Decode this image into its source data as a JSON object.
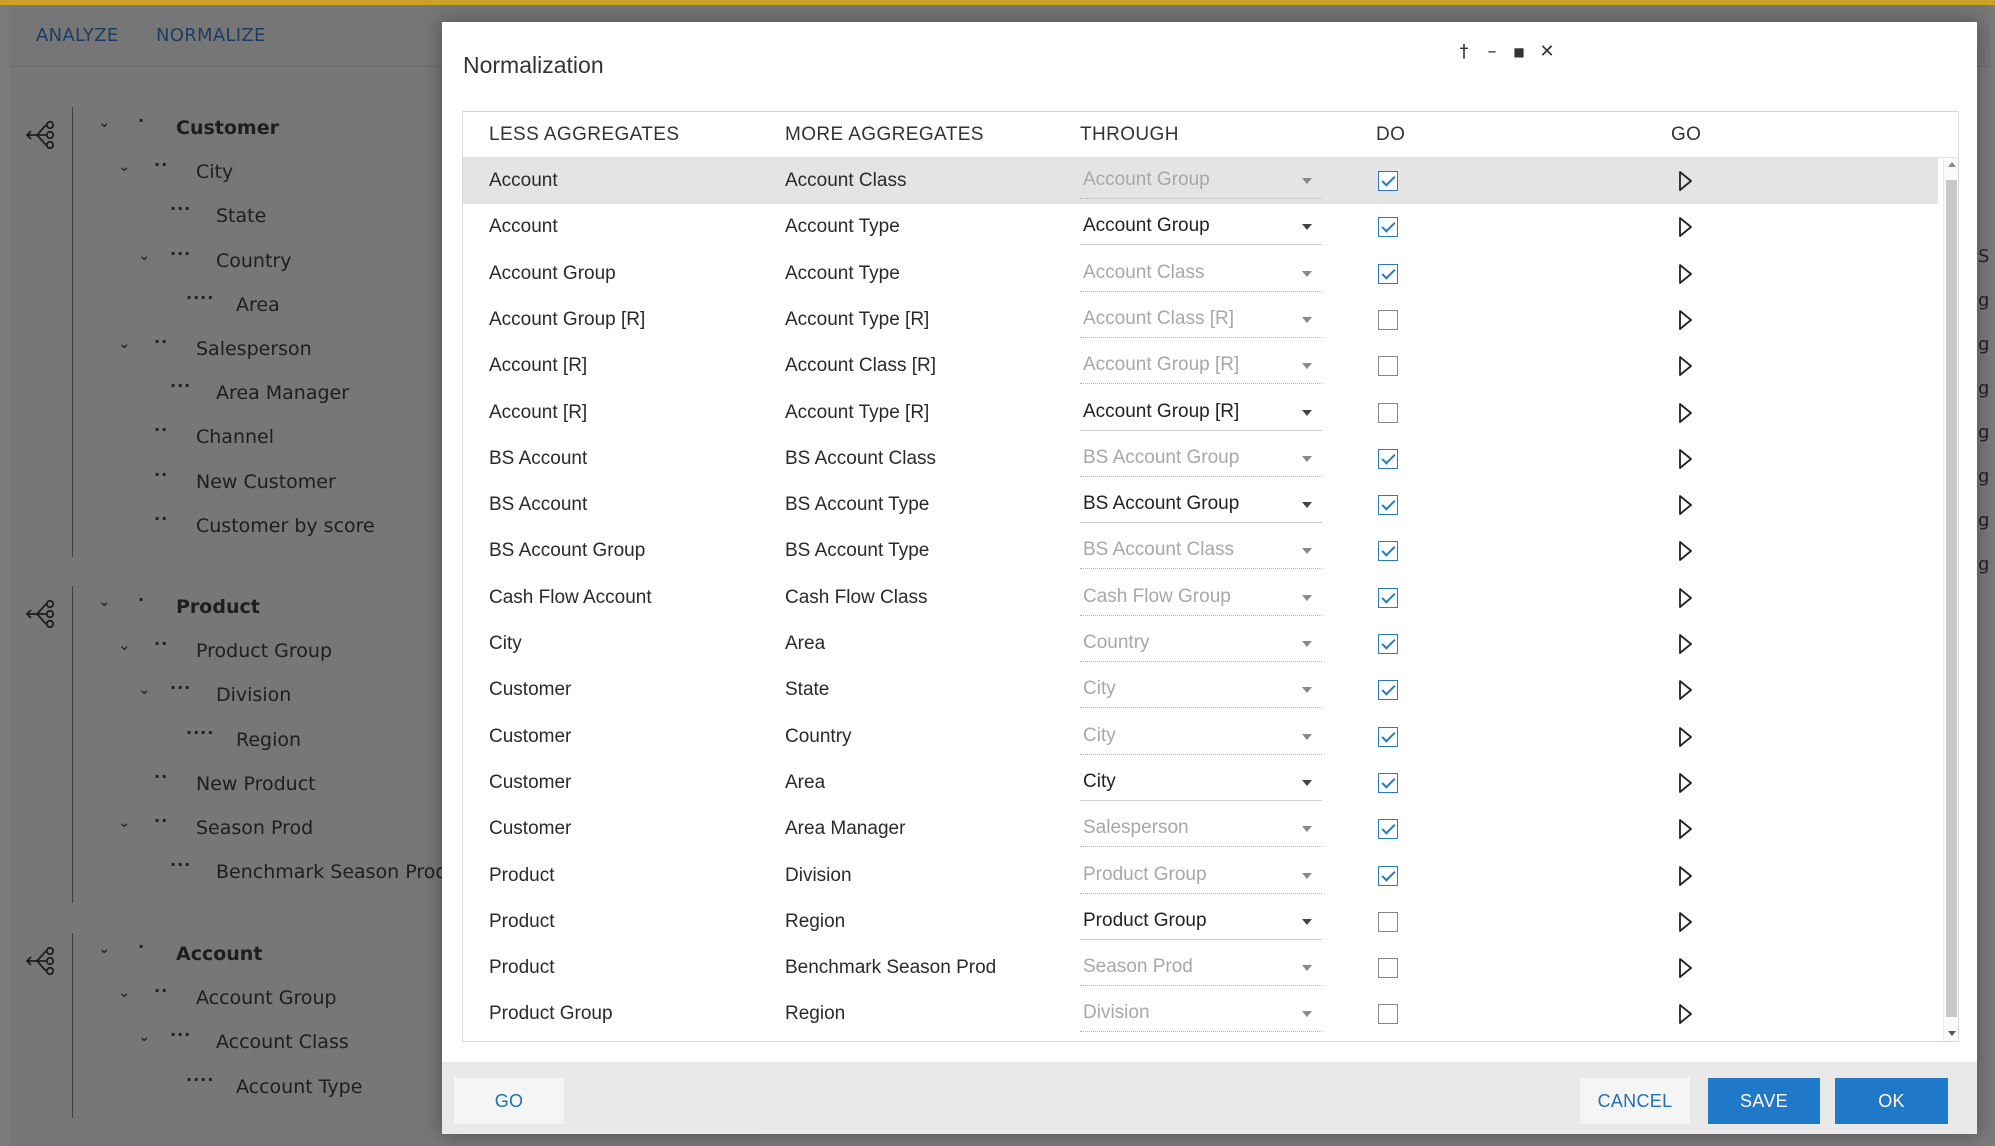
{
  "background": {
    "tabs": [
      "ANALYZE",
      "NORMALIZE"
    ],
    "tree_groups": [
      {
        "icon": "hierarchy-icon",
        "nodes": [
          {
            "label": "Customer",
            "level": 0,
            "expanded": true
          },
          {
            "label": "City",
            "level": 1,
            "expanded": true
          },
          {
            "label": "State",
            "level": 2,
            "expanded": false
          },
          {
            "label": "Country",
            "level": 2,
            "expanded": true
          },
          {
            "label": "Area",
            "level": 3,
            "expanded": false
          },
          {
            "label": "Salesperson",
            "level": 1,
            "expanded": true
          },
          {
            "label": "Area Manager",
            "level": 2,
            "expanded": false
          },
          {
            "label": "Channel",
            "level": 1,
            "expanded": false
          },
          {
            "label": "New Customer",
            "level": 1,
            "expanded": false
          },
          {
            "label": "Customer by score",
            "level": 1,
            "expanded": false
          }
        ]
      },
      {
        "icon": "hierarchy-icon",
        "nodes": [
          {
            "label": "Product",
            "level": 0,
            "expanded": true
          },
          {
            "label": "Product Group",
            "level": 1,
            "expanded": true
          },
          {
            "label": "Division",
            "level": 2,
            "expanded": true
          },
          {
            "label": "Region",
            "level": 3,
            "expanded": false
          },
          {
            "label": "New Product",
            "level": 1,
            "expanded": false
          },
          {
            "label": "Season Prod",
            "level": 1,
            "expanded": true
          },
          {
            "label": "Benchmark Season Prod",
            "level": 2,
            "expanded": false
          }
        ]
      },
      {
        "icon": "hierarchy-icon",
        "nodes": [
          {
            "label": "Account",
            "level": 0,
            "expanded": true
          },
          {
            "label": "Account Group",
            "level": 1,
            "expanded": true
          },
          {
            "label": "Account Class",
            "level": 2,
            "expanded": true
          },
          {
            "label": "Account Type",
            "level": 3,
            "expanded": false
          }
        ]
      }
    ],
    "right_edge_glyphs": [
      "S",
      "g",
      "g",
      "g",
      "g",
      "g",
      "g",
      "g"
    ]
  },
  "modal": {
    "title": "Normalization",
    "controls": {
      "pin": "†",
      "minimize": "–",
      "maximize": "■",
      "close": "✕"
    },
    "columns": {
      "less": "LESS AGGREGATES",
      "more": "MORE AGGREGATES",
      "through": "THROUGH",
      "do": "DO",
      "go": "GO"
    },
    "rows": [
      {
        "less": "Account",
        "more": "Account Class",
        "through": "Account Group",
        "active": false,
        "do": true,
        "selected": true
      },
      {
        "less": "Account",
        "more": "Account Type",
        "through": "Account Group",
        "active": true,
        "do": true,
        "selected": false
      },
      {
        "less": "Account Group",
        "more": "Account Type",
        "through": "Account Class",
        "active": false,
        "do": true,
        "selected": false
      },
      {
        "less": "Account Group [R]",
        "more": "Account Type [R]",
        "through": "Account Class [R]",
        "active": false,
        "do": false,
        "selected": false
      },
      {
        "less": "Account [R]",
        "more": "Account Class [R]",
        "through": "Account Group [R]",
        "active": false,
        "do": false,
        "selected": false
      },
      {
        "less": "Account [R]",
        "more": "Account Type [R]",
        "through": "Account Group [R]",
        "active": true,
        "do": false,
        "selected": false
      },
      {
        "less": "BS Account",
        "more": "BS Account Class",
        "through": "BS Account Group",
        "active": false,
        "do": true,
        "selected": false
      },
      {
        "less": "BS Account",
        "more": "BS Account Type",
        "through": "BS Account Group",
        "active": true,
        "do": true,
        "selected": false
      },
      {
        "less": "BS Account Group",
        "more": "BS Account Type",
        "through": "BS Account Class",
        "active": false,
        "do": true,
        "selected": false
      },
      {
        "less": "Cash Flow Account",
        "more": "Cash Flow Class",
        "through": "Cash Flow Group",
        "active": false,
        "do": true,
        "selected": false
      },
      {
        "less": "City",
        "more": "Area",
        "through": "Country",
        "active": false,
        "do": true,
        "selected": false
      },
      {
        "less": "Customer",
        "more": "State",
        "through": "City",
        "active": false,
        "do": true,
        "selected": false
      },
      {
        "less": "Customer",
        "more": "Country",
        "through": "City",
        "active": false,
        "do": true,
        "selected": false
      },
      {
        "less": "Customer",
        "more": "Area",
        "through": "City",
        "active": true,
        "do": true,
        "selected": false
      },
      {
        "less": "Customer",
        "more": "Area Manager",
        "through": "Salesperson",
        "active": false,
        "do": true,
        "selected": false
      },
      {
        "less": "Product",
        "more": "Division",
        "through": "Product Group",
        "active": false,
        "do": true,
        "selected": false
      },
      {
        "less": "Product",
        "more": "Region",
        "through": "Product Group",
        "active": true,
        "do": false,
        "selected": false
      },
      {
        "less": "Product",
        "more": "Benchmark Season Prod",
        "through": "Season Prod",
        "active": false,
        "do": false,
        "selected": false
      },
      {
        "less": "Product Group",
        "more": "Region",
        "through": "Division",
        "active": false,
        "do": false,
        "selected": false
      }
    ],
    "footer": {
      "go": "GO",
      "cancel": "CANCEL",
      "save": "SAVE",
      "ok": "OK"
    }
  },
  "colors": {
    "accent": "#1f78c8",
    "checkbox": "#2a7ac0",
    "top_strip": "#c9a227",
    "nav_text": "#1e3c63"
  }
}
